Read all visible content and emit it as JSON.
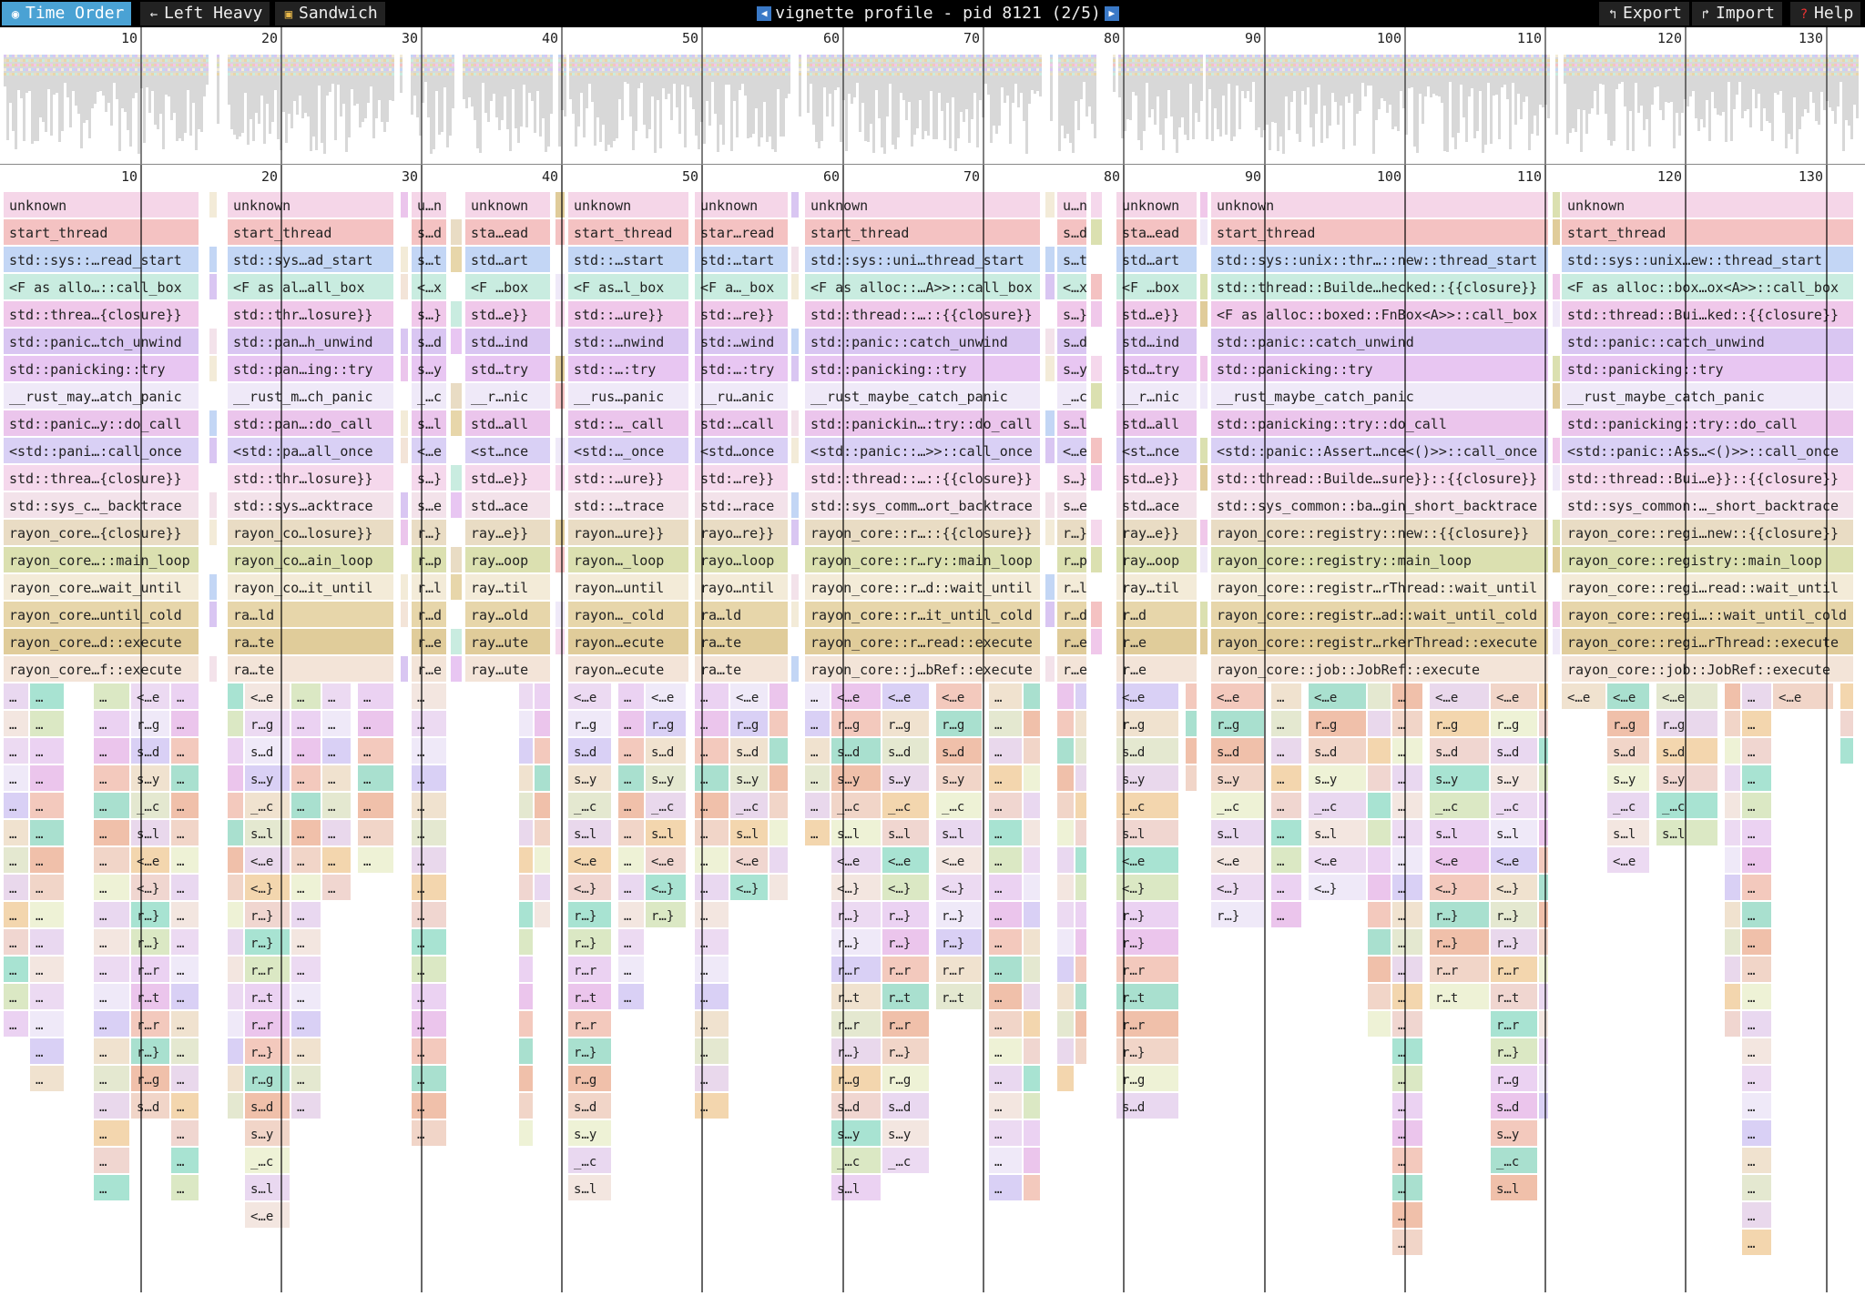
{
  "toolbar": {
    "tabs": [
      {
        "label": "Time Order",
        "icon": "rabbit-icon",
        "active": true
      },
      {
        "label": "Left Heavy",
        "icon": "left-arrow-icon",
        "active": false
      },
      {
        "label": "Sandwich",
        "icon": "sandwich-icon",
        "active": false
      }
    ],
    "title": "vignette profile - pid 8121 (2/5)",
    "prev_icon": "left-arrow-icon",
    "next_icon": "right-arrow-icon",
    "actions": [
      {
        "label": "Export",
        "icon": "export-icon"
      },
      {
        "label": "Import",
        "icon": "import-icon"
      },
      {
        "label": "Help",
        "icon": "help-icon"
      }
    ]
  },
  "colors": {
    "toolbar_bg": "#000000",
    "active_tab": "#4aa2d4",
    "nav_arrow": "#3a79c7",
    "minimap_bg": "#d8d8d8",
    "grid": "#000000"
  },
  "axis": {
    "ticks": [
      "10",
      "20",
      "30",
      "40",
      "50",
      "60",
      "70",
      "80",
      "90",
      "100",
      "110",
      "120",
      "130"
    ]
  },
  "stack_names": [
    "unknown",
    "start_thread",
    "std::sys::unix::thread::Thread::new::thread_start",
    "<F as alloc::boxed::FnBox<A>>::call_box",
    "std::thread::Builder::spawn_unchecked::{{closure}}",
    "std::panic::catch_unwind",
    "std::panicking::try",
    "__rust_maybe_catch_panic",
    "std::panicking::try::do_call",
    "<std::panic::AssertUnwindSafe<F> as core::ops::function::FnOnce<()>>::call_once",
    "std::thread::Builder::spawn_unchecked::{{closure}}::{{closure}}",
    "std::sys_common::backtrace::__rust_begin_short_backtrace",
    "rayon_core::registry::Registry::new::{{closure}}",
    "rayon_core::registry::main_loop",
    "rayon_core::registry::WorkerThread::wait_until",
    "rayon_core::registry::WorkerThread::wait_until_cold",
    "rayon_core::registry::WorkerThread::execute",
    "rayon_core::job::JobRef::execute",
    "<rayon_core::job::StackJob<L,F,R> as rayon_core::job::Job>::execute",
    "rayon_core::job::JobResult::call::{{closure}}::binding",
    "std::panic::catch_unwind",
    "std::panicking::try",
    "__rust_maybe_catch_panic",
    "std::panicking::try::do_call",
    "<std::panic::AssertUnwindSafe<F> as core::ops::function::FnOnce<()>>::call_once",
    "<rayon_core::job::StackJob<L,F,R> as rayon_core::job::Job>::execute::{{closure}}",
    "rayon::iter::plumbing::bridge_producer_consumer::helper::{{closure}}",
    "rayon_core::join::join_context::{{closure}}",
    "rayon::iter::plumbing::bridge_producer_consumer::helper",
    "rayon_core::join::join_context",
    "rayon_core::registry::in_worker"
  ],
  "lanes": [
    {
      "segments": [
        [
          "unknown",
          "unknown",
          "unknown",
          "unknown",
          "unknown",
          "unknown",
          "unknown",
          "unknown",
          "unknown",
          "unknown",
          "unknown",
          "unknown",
          "unknown",
          "unknown",
          "unknown",
          "unknown",
          "unknown",
          "unknown",
          "unknown",
          "unknown",
          "unknown",
          "unknown",
          "unknown",
          "unknown",
          "unknown",
          "unknown",
          "unknown",
          "unknown",
          "unknown",
          "unknown",
          "unknown",
          "unknown",
          "unknown",
          "unknown",
          "unknown",
          "unknown",
          "unknown",
          "unknown",
          "unknown",
          "unknown"
        ],
        [
          "start_thread",
          "start_thread",
          "start_thread",
          "start_thread",
          "start_thread",
          "start_thread",
          "start_thread",
          "start_thread",
          "start_thread",
          "start_thread",
          "start_thread",
          "start_thread",
          "start_thread",
          "start_thread",
          "start_thread",
          "start_thread",
          "start_thread",
          "start_thread",
          "start_thread",
          "start_thread"
        ]
      ]
    }
  ],
  "frames": [
    {
      "depth": 0,
      "label": "unknown",
      "color": "#f5d6e8"
    },
    {
      "depth": 1,
      "label": "start_thread",
      "color": "#f4c2c2"
    },
    {
      "depth": 2,
      "label": "std::sys::unix::thread::Thread::new::thread_start",
      "color": "#c3d6f5"
    },
    {
      "depth": 3,
      "label": "<F as alloc::boxed::FnBox<A>>::call_box",
      "color": "#c9ece0"
    },
    {
      "depth": 4,
      "label": "std::thread::Builder::spawn_unchecked::{{closure}}",
      "color": "#f0c8ea"
    },
    {
      "depth": 5,
      "label": "std::panic::catch_unwind",
      "color": "#d9c6f2"
    },
    {
      "depth": 6,
      "label": "std::panicking::try",
      "color": "#e8c6f2"
    },
    {
      "depth": 7,
      "label": "__rust_maybe_catch_panic",
      "color": "#efe9f8"
    },
    {
      "depth": 8,
      "label": "std::panicking::try::do_call",
      "color": "#ebc5ec"
    },
    {
      "depth": 9,
      "label": "<std::panic::AssertUnwindSafe<F> as core::ops::function::FnOnce<()>>::call_once",
      "color": "#d9d0f5"
    },
    {
      "depth": 10,
      "label": "std::thread::Builder::spawn_unchecked::{{closure}}::{{closure}}",
      "color": "#f5d8ec"
    },
    {
      "depth": 11,
      "label": "std::sys_common::backtrace::__rust_begin_short_backtrace",
      "color": "#f3e2ea"
    },
    {
      "depth": 12,
      "label": "rayon_core::registry::Registry::new::{{closure}}",
      "color": "#e9dcc4"
    },
    {
      "depth": 13,
      "label": "rayon_core::registry::main_loop",
      "color": "#dbe0b0"
    },
    {
      "depth": 14,
      "label": "rayon_core::registry::WorkerThread::wait_until",
      "color": "#f3ebd8"
    },
    {
      "depth": 15,
      "label": "rayon_core::registry::WorkerThread::wait_until_cold",
      "color": "#e7d6aa"
    },
    {
      "depth": 16,
      "label": "rayon_core::registry::WorkerThread::execute",
      "color": "#e0cc9a"
    },
    {
      "depth": 17,
      "label": "rayon_core::job::JobRef::execute",
      "color": "#f3e4d8"
    }
  ],
  "columns": [
    {
      "name": "col-1",
      "labels": [
        "unknown",
        "start_thread",
        "std::sys::…read_start",
        "<F as allo…::call_box",
        "std::threa…{closure}}",
        "std::panic…tch_unwind",
        "std::panicking::try",
        "__rust_may…atch_panic",
        "std::panic…y::do_call",
        "<std::pani…:call_once",
        "std::threa…{closure}}",
        "std::sys_c…_backtrace",
        "rayon_core…{closure}}",
        "rayon_core…::main_loop",
        "rayon_core…wait_until",
        "rayon_core…until_cold",
        "rayon_core…d::execute",
        "rayon_core…f::execute"
      ]
    },
    {
      "name": "col-2",
      "labels": [
        "unknown",
        "start_thread",
        "std::sys…ad_start",
        "<F as al…all_box",
        "std::thr…losure}}",
        "std::pan…h_unwind",
        "std::pan…ing::try",
        "__rust_m…ch_panic",
        "std::pan…:do_call",
        "<std::pa…all_once",
        "std::thr…losure}}",
        "std::sys…acktrace",
        "rayon_co…losure}}",
        "rayon_co…ain_loop",
        "rayon_co…it_until",
        "ra…ld",
        "ra…te",
        "ra…te"
      ]
    },
    {
      "name": "col-3",
      "labels": [
        "u…n",
        "s…d",
        "s…t",
        "<…x",
        "s…}",
        "s…d",
        "s…y",
        "_…c",
        "s…l",
        "<…e",
        "s…}",
        "s…e",
        "r…}",
        "r…p",
        "r…l",
        "r…d",
        "r…e",
        "r…e"
      ]
    },
    {
      "name": "col-4",
      "labels": [
        "unknown",
        "sta…ead",
        "std…art",
        "<F …box",
        "std…e}}",
        "std…ind",
        "std…try",
        "__r…nic",
        "std…all",
        "<st…nce",
        "std…e}}",
        "std…ace",
        "ray…e}}",
        "ray…oop",
        "ray…til",
        "ray…old",
        "ray…ute",
        "ray…ute"
      ]
    },
    {
      "name": "col-5",
      "labels": [
        "unknown",
        "start_thread",
        "std::…start",
        "<F as…l_box",
        "std::…ure}}",
        "std::…nwind",
        "std::…:try",
        "__rus…panic",
        "std::…_call",
        "<std:…_once",
        "std::…ure}}",
        "std::…trace",
        "rayon…ure}}",
        "rayon…_loop",
        "rayon…until",
        "rayon…_cold",
        "rayon…ecute",
        "rayon…ecute"
      ]
    },
    {
      "name": "col-6",
      "labels": [
        "unknown",
        "star…read",
        "std:…tart",
        "<F a…_box",
        "std:…re}}",
        "std:…wind",
        "std:…:try",
        "__ru…anic",
        "std:…call",
        "<std…once",
        "std:…re}}",
        "std:…race",
        "rayo…re}}",
        "rayo…loop",
        "rayo…ntil",
        "ra…ld",
        "ra…te",
        "ra…te"
      ]
    },
    {
      "name": "col-7",
      "labels": [
        "unknown",
        "start_thread",
        "std::sys::uni…thread_start",
        "<F as alloc::…A>>::call_box",
        "std::thread::…::{{closure}}",
        "std::panic::catch_unwind",
        "std::panicking::try",
        "__rust_maybe_catch_panic",
        "std::panickin…:try::do_call",
        "<std::panic::…>>::call_once",
        "std::thread::…::{{closure}}",
        "std::sys_comm…ort_backtrace",
        "rayon_core::r…::{{closure}}",
        "rayon_core::r…ry::main_loop",
        "rayon_core::r…d::wait_until",
        "rayon_core::r…it_until_cold",
        "rayon_core::r…read::execute",
        "rayon_core::j…bRef::execute"
      ]
    },
    {
      "name": "col-8",
      "labels": [
        "u…n",
        "s…d",
        "s…t",
        "<…x",
        "s…}",
        "s…d",
        "s…y",
        "_…c",
        "s…l",
        "<…e",
        "s…}",
        "s…e",
        "r…}",
        "r…p",
        "r…l",
        "r…d",
        "r…e",
        "r…e"
      ]
    },
    {
      "name": "col-9",
      "labels": [
        "unknown",
        "sta…ead",
        "std…art",
        "<F …box",
        "std…e}}",
        "std…ind",
        "std…try",
        "__r…nic",
        "std…all",
        "<st…nce",
        "std…e}}",
        "std…ace",
        "ray…e}}",
        "ray…oop",
        "ray…til",
        "r…d",
        "r…e",
        "r…e"
      ]
    },
    {
      "name": "col-10",
      "labels": [
        "unknown",
        "start_thread",
        "std::sys::unix::thr…::new::thread_start",
        "std::thread::Builde…hecked::{{closure}}",
        "<F as alloc::boxed::FnBox<A>>::call_box",
        "std::panic::catch_unwind",
        "std::panicking::try",
        "__rust_maybe_catch_panic",
        "std::panicking::try::do_call",
        "<std::panic::Assert…nce<()>>::call_once",
        "std::thread::Builde…sure}}::{{closure}}",
        "std::sys_common::ba…gin_short_backtrace",
        "rayon_core::registry::new::{{closure}}",
        "rayon_core::registry::main_loop",
        "rayon_core::registr…rThread::wait_until",
        "rayon_core::registr…ad::wait_until_cold",
        "rayon_core::registr…rkerThread::execute",
        "rayon_core::job::JobRef::execute"
      ]
    },
    {
      "name": "col-11",
      "labels": [
        "unknown",
        "start_thread",
        "std::sys::unix…ew::thread_start",
        "<F as alloc::box…ox<A>>::call_box",
        "std::thread::Bui…ked::{{closure}}",
        "std::panic::catch_unwind",
        "std::panicking::try",
        "__rust_maybe_catch_panic",
        "std::panicking::try::do_call",
        "<std::panic::Ass…<()>>::call_once",
        "std::thread::Bui…e}}::{{closure}}",
        "std::sys_common:…_short_backtrace",
        "rayon_core::regi…new::{{closure}}",
        "rayon_core::registry::main_loop",
        "rayon_core::regi…read::wait_until",
        "rayon_core::regi…::wait_until_cold",
        "rayon_core::regi…rThread::execute",
        "rayon_core::job::JobRef::execute"
      ]
    }
  ]
}
